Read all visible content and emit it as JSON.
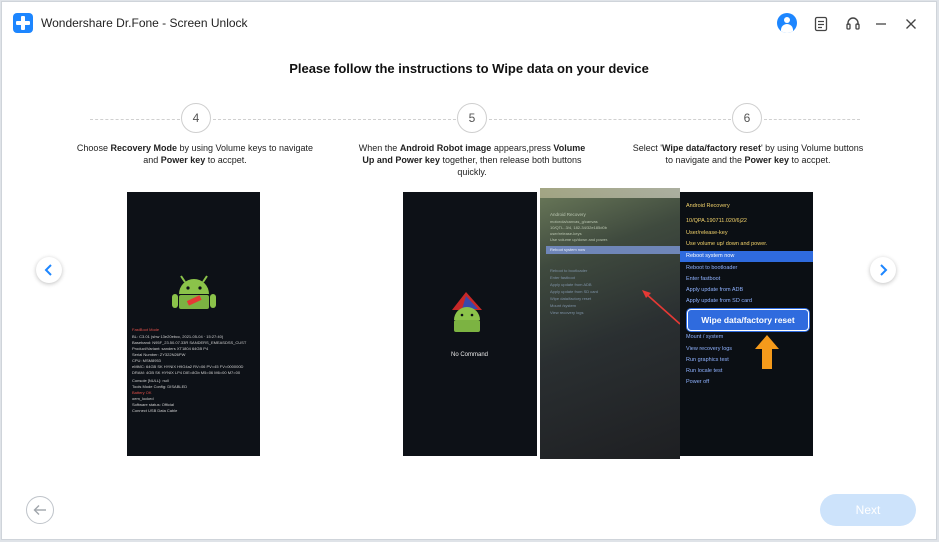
{
  "window": {
    "title": "Wondershare Dr.Fone - Screen Unlock"
  },
  "heading": "Please follow the instructions to Wipe data on your device",
  "steps": [
    {
      "number": "4",
      "desc_parts": [
        "Choose ",
        "Recovery Mode",
        " by using Volume keys to navigate and ",
        "Power key",
        " to accpet."
      ]
    },
    {
      "number": "5",
      "desc_parts": [
        "When the ",
        "Android Robot image",
        " appears,press ",
        "Volume Up and Power key",
        " together, then release both buttons quickly."
      ]
    },
    {
      "number": "6",
      "desc_parts": [
        "Select '",
        "Wipe data/factory reset",
        "' by using Volume buttons to navigate and the ",
        "Power key",
        " to accpet."
      ]
    }
  ],
  "phone4": {
    "lines": [
      "FastBoot Mode",
      "BL: C3.01 (shw 13e20ebcc, 2021-05-04 · 15:27:40)",
      "Baseband: N95F_23.50.07.33R  SANDERS_EMEASDSS_CUST",
      "Product/Variant: sanders XT1804  64GB  P4",
      "Serial Number: ZY322N26PW",
      "CPU: MSM8953",
      "eMMC: 64GB  SK HYNIX  H9G4a2  RV=06 PV=45 FV=000000D",
      "DRAM: 4GB  SK HYNIX  LP4  DIE=8Gb  M5=06  M6=00  M7=00",
      "Console [NULL]: null",
      "Tools Mode Config: DISABLED",
      "Battery OK",
      "oem_locked",
      "Software status: Official",
      "Connect USB Data Cable"
    ]
  },
  "phone5": {
    "no_command": "No Command"
  },
  "photo": {
    "lines": [
      "Android Recovery",
      "motorola/canvas_g/canvas",
      "10/QTL..3/4, 182-34/32e185d0b",
      "user/release-keys",
      "Use volume up/down and power.",
      "Reboot system now",
      "Reboot to bootloader",
      "Enter fastboot",
      "Apply update from ADB",
      "Apply update from SD card",
      "Wipe data/factory reset",
      "Mount /system",
      "View recovery logs"
    ]
  },
  "recovery": {
    "header": [
      "Android Recovery",
      "10/QPA.190711.020/6j22",
      "User/release-key",
      "Use volume up/ down and power."
    ],
    "selected": "Reboot system now",
    "items_before": [
      "Reboot to bootloader",
      "Enter fastboot",
      "Apply update from ADB",
      "Apply update from SD card"
    ],
    "highlight": "Wipe data/factory reset",
    "items_after": [
      "Mount / system",
      "View recovery logs",
      "Run graphics test",
      "Run locale test",
      "Power off"
    ]
  },
  "nav": {
    "prev_icon": "chevron-left-icon",
    "next_icon": "chevron-right-icon"
  },
  "footer": {
    "back_icon": "arrow-left-icon",
    "next_label": "Next"
  },
  "colors": {
    "accent": "#1d86ff",
    "next_disabled": "#cde3fb"
  }
}
